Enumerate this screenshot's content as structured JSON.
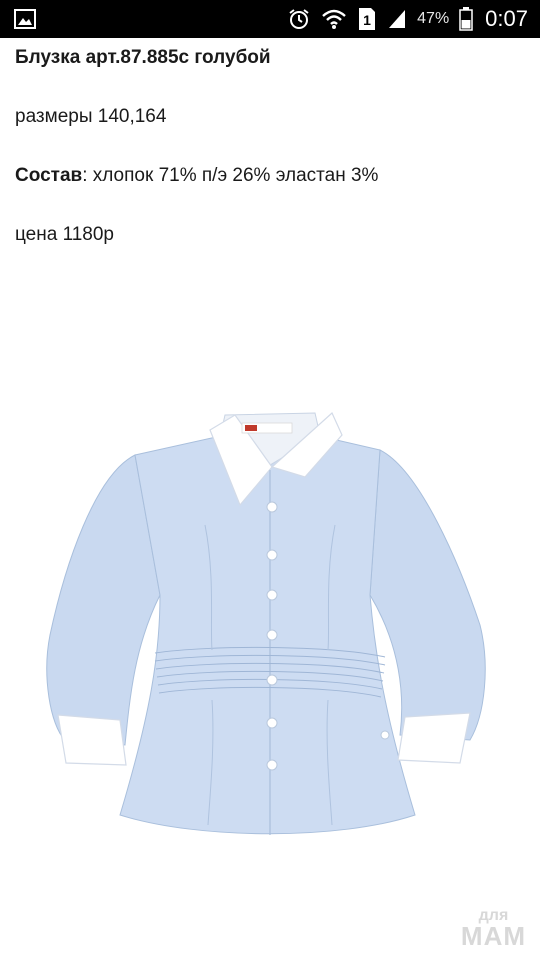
{
  "status_bar": {
    "left_icons": [
      "image-icon"
    ],
    "right_icons": [
      "alarm-icon",
      "wifi-icon",
      "sim-1-icon",
      "signal-icon",
      "battery-icon"
    ],
    "battery_percent": "47%",
    "time": "0:07"
  },
  "product": {
    "title": "Блузка арт.87.885с голубой",
    "sizes": "размеры 140,164",
    "composition_label": "Состав",
    "composition_value": ": хлопок 71% п/э 26% эластан 3%",
    "price": "цена 1180р"
  },
  "image": {
    "subject": "light-blue blouse with white collar and cuffs",
    "colors": {
      "shirt": "#c7d8ef",
      "collar": "#ffffff",
      "stitch": "#9fb6d6"
    }
  },
  "watermark": {
    "line1": "для",
    "line2": "МАМ"
  }
}
